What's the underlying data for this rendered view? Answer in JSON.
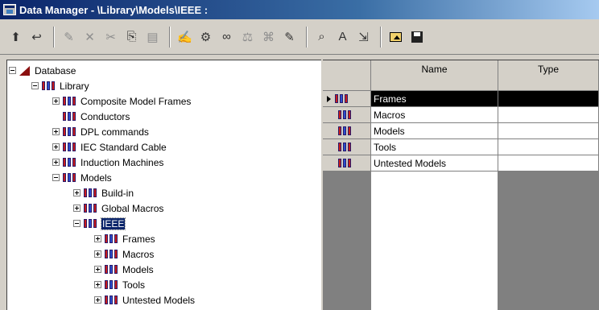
{
  "window": {
    "title": "Data Manager - \\Library\\Models\\IEEE :"
  },
  "toolbar": {
    "buttons": [
      {
        "name": "up-folder-icon",
        "glyph": "⮬",
        "enabled": true
      },
      {
        "name": "parent-folder-icon",
        "glyph": "⮬",
        "enabled": true
      },
      {
        "name": "new-icon",
        "glyph": "✎",
        "enabled": false
      },
      {
        "name": "delete-icon",
        "glyph": "✕",
        "enabled": false
      },
      {
        "name": "cut-icon",
        "glyph": "✂",
        "enabled": false
      },
      {
        "name": "copy-icon",
        "glyph": "⎘",
        "enabled": true
      },
      {
        "name": "paste-icon",
        "glyph": "📋",
        "enabled": false
      },
      {
        "name": "edit-icon",
        "glyph": "✍",
        "enabled": true
      },
      {
        "name": "settings-icon",
        "glyph": "⚙",
        "enabled": true
      },
      {
        "name": "glasses-icon",
        "glyph": "∞",
        "enabled": true
      },
      {
        "name": "filter-icon",
        "glyph": "⚖",
        "enabled": false
      },
      {
        "name": "tree-icon",
        "glyph": "⌘",
        "enabled": false
      },
      {
        "name": "edit-object-icon",
        "glyph": "✎",
        "enabled": true
      },
      {
        "name": "find-icon",
        "glyph": "⌕",
        "enabled": true
      },
      {
        "name": "font-icon",
        "glyph": "A",
        "enabled": true
      },
      {
        "name": "export-icon",
        "glyph": "⇲",
        "enabled": true
      },
      {
        "name": "open-folder-icon",
        "glyph": "",
        "enabled": true
      },
      {
        "name": "save-icon",
        "glyph": "",
        "enabled": true
      }
    ]
  },
  "tree": {
    "root": "Database",
    "library": "Library",
    "items": [
      "Composite Model Frames",
      "Conductors",
      "DPL commands",
      "IEC Standard Cable",
      "Induction Machines",
      "Models",
      "Build-in",
      "Global Macros",
      "IEEE",
      "Frames",
      "Macros",
      "Models",
      "Tools",
      "Untested Models"
    ]
  },
  "grid": {
    "columns": [
      "Name",
      "Type"
    ],
    "rows": [
      "Frames",
      "Macros",
      "Models",
      "Tools",
      "Untested Models"
    ]
  }
}
